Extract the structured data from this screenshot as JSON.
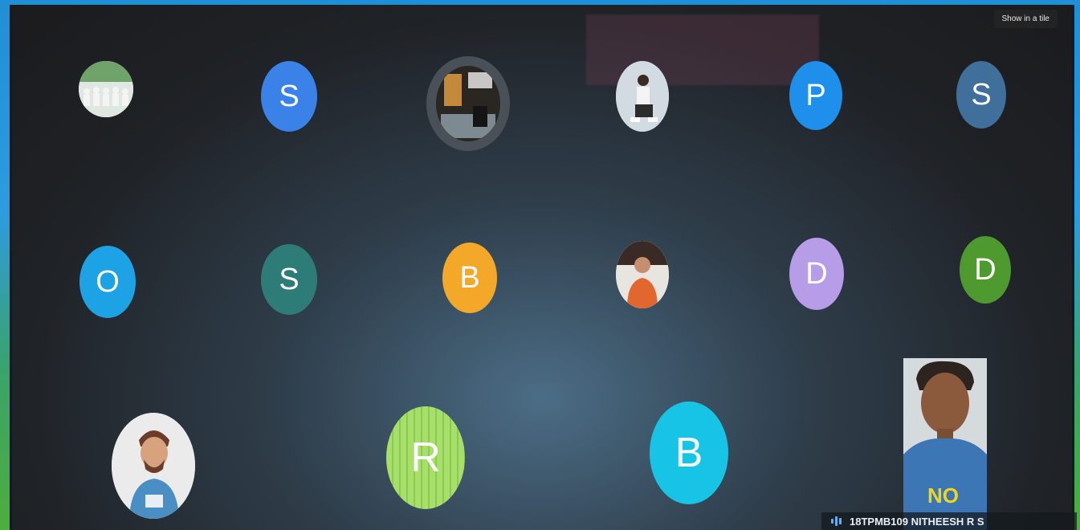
{
  "meeting": {
    "show_in_tile_label": "Show in a tile",
    "self_name": "18TPMB109 NITHEESH R S"
  },
  "participants": [
    {
      "type": "photo",
      "icon": "group-photo-avatar",
      "color": "#ffffff"
    },
    {
      "type": "initial",
      "letter": "S",
      "color": "#3b82e8"
    },
    {
      "type": "photo",
      "icon": "room-photo-avatar",
      "color": "#2b2b2b"
    },
    {
      "type": "photo",
      "icon": "person-sitting-avatar",
      "color": "#c9d3dc"
    },
    {
      "type": "initial",
      "letter": "P",
      "color": "#1e8fea"
    },
    {
      "type": "initial",
      "letter": "S",
      "color": "#3f6f9a"
    },
    {
      "type": "initial",
      "letter": "O",
      "color": "#1da2e6"
    },
    {
      "type": "initial",
      "letter": "S",
      "color": "#2e7c78"
    },
    {
      "type": "initial",
      "letter": "B",
      "color": "#f4a82a"
    },
    {
      "type": "photo",
      "icon": "woman-orange-avatar",
      "color": "#e8e0d8"
    },
    {
      "type": "initial",
      "letter": "D",
      "color": "#b79ce8"
    },
    {
      "type": "initial",
      "letter": "D",
      "color": "#4e9a2e"
    },
    {
      "type": "photo",
      "icon": "man-portrait-avatar",
      "color": "#e9e9e9"
    },
    {
      "type": "initial",
      "letter": "R",
      "color": "#a6e06a"
    },
    {
      "type": "initial",
      "letter": "B",
      "color": "#18c4e6"
    }
  ]
}
